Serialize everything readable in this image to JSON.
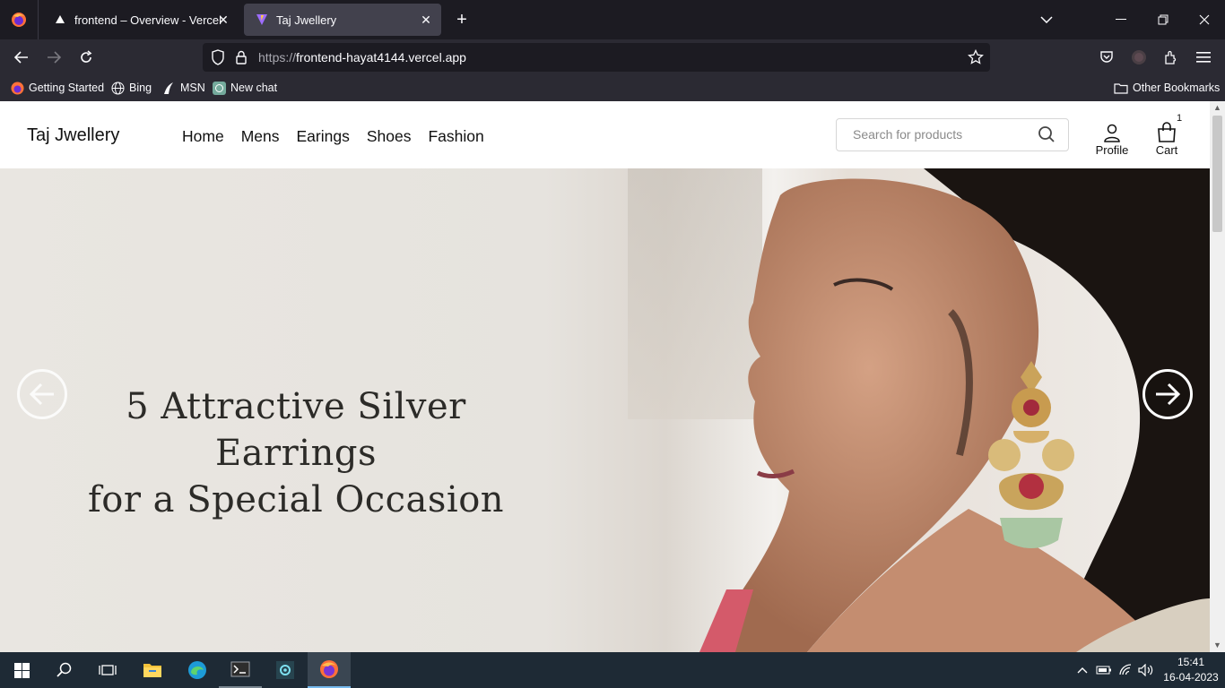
{
  "browser": {
    "tabs": [
      {
        "title": "frontend – Overview - Vercel",
        "active": false
      },
      {
        "title": "Taj Jwellery",
        "active": true
      }
    ],
    "url_protocol": "https://",
    "url_host": "frontend-hayat4144.vercel.app",
    "bookmarks": [
      {
        "label": "Getting Started",
        "icon": "firefox-icon"
      },
      {
        "label": "Bing",
        "icon": "globe-icon"
      },
      {
        "label": "MSN",
        "icon": "msn-icon"
      },
      {
        "label": "New chat",
        "icon": "chatgpt-icon"
      }
    ],
    "other_bookmarks": "Other Bookmarks"
  },
  "site": {
    "brand": "Taj Jwellery",
    "nav": [
      "Home",
      "Mens",
      "Earings",
      "Shoes",
      "Fashion"
    ],
    "search_placeholder": "Search for products",
    "profile_label": "Profile",
    "cart_label": "Cart",
    "cart_count": "1"
  },
  "hero": {
    "title_line1": "5 Attractive Silver Earrings",
    "title_line2": "for a Special Occasion"
  },
  "taskbar": {
    "time": "15:41",
    "date": "16-04-2023"
  },
  "colors": {
    "browser_bg": "#1c1b22",
    "toolbar_bg": "#2b2a33",
    "taskbar_bg": "#1e2a35"
  }
}
